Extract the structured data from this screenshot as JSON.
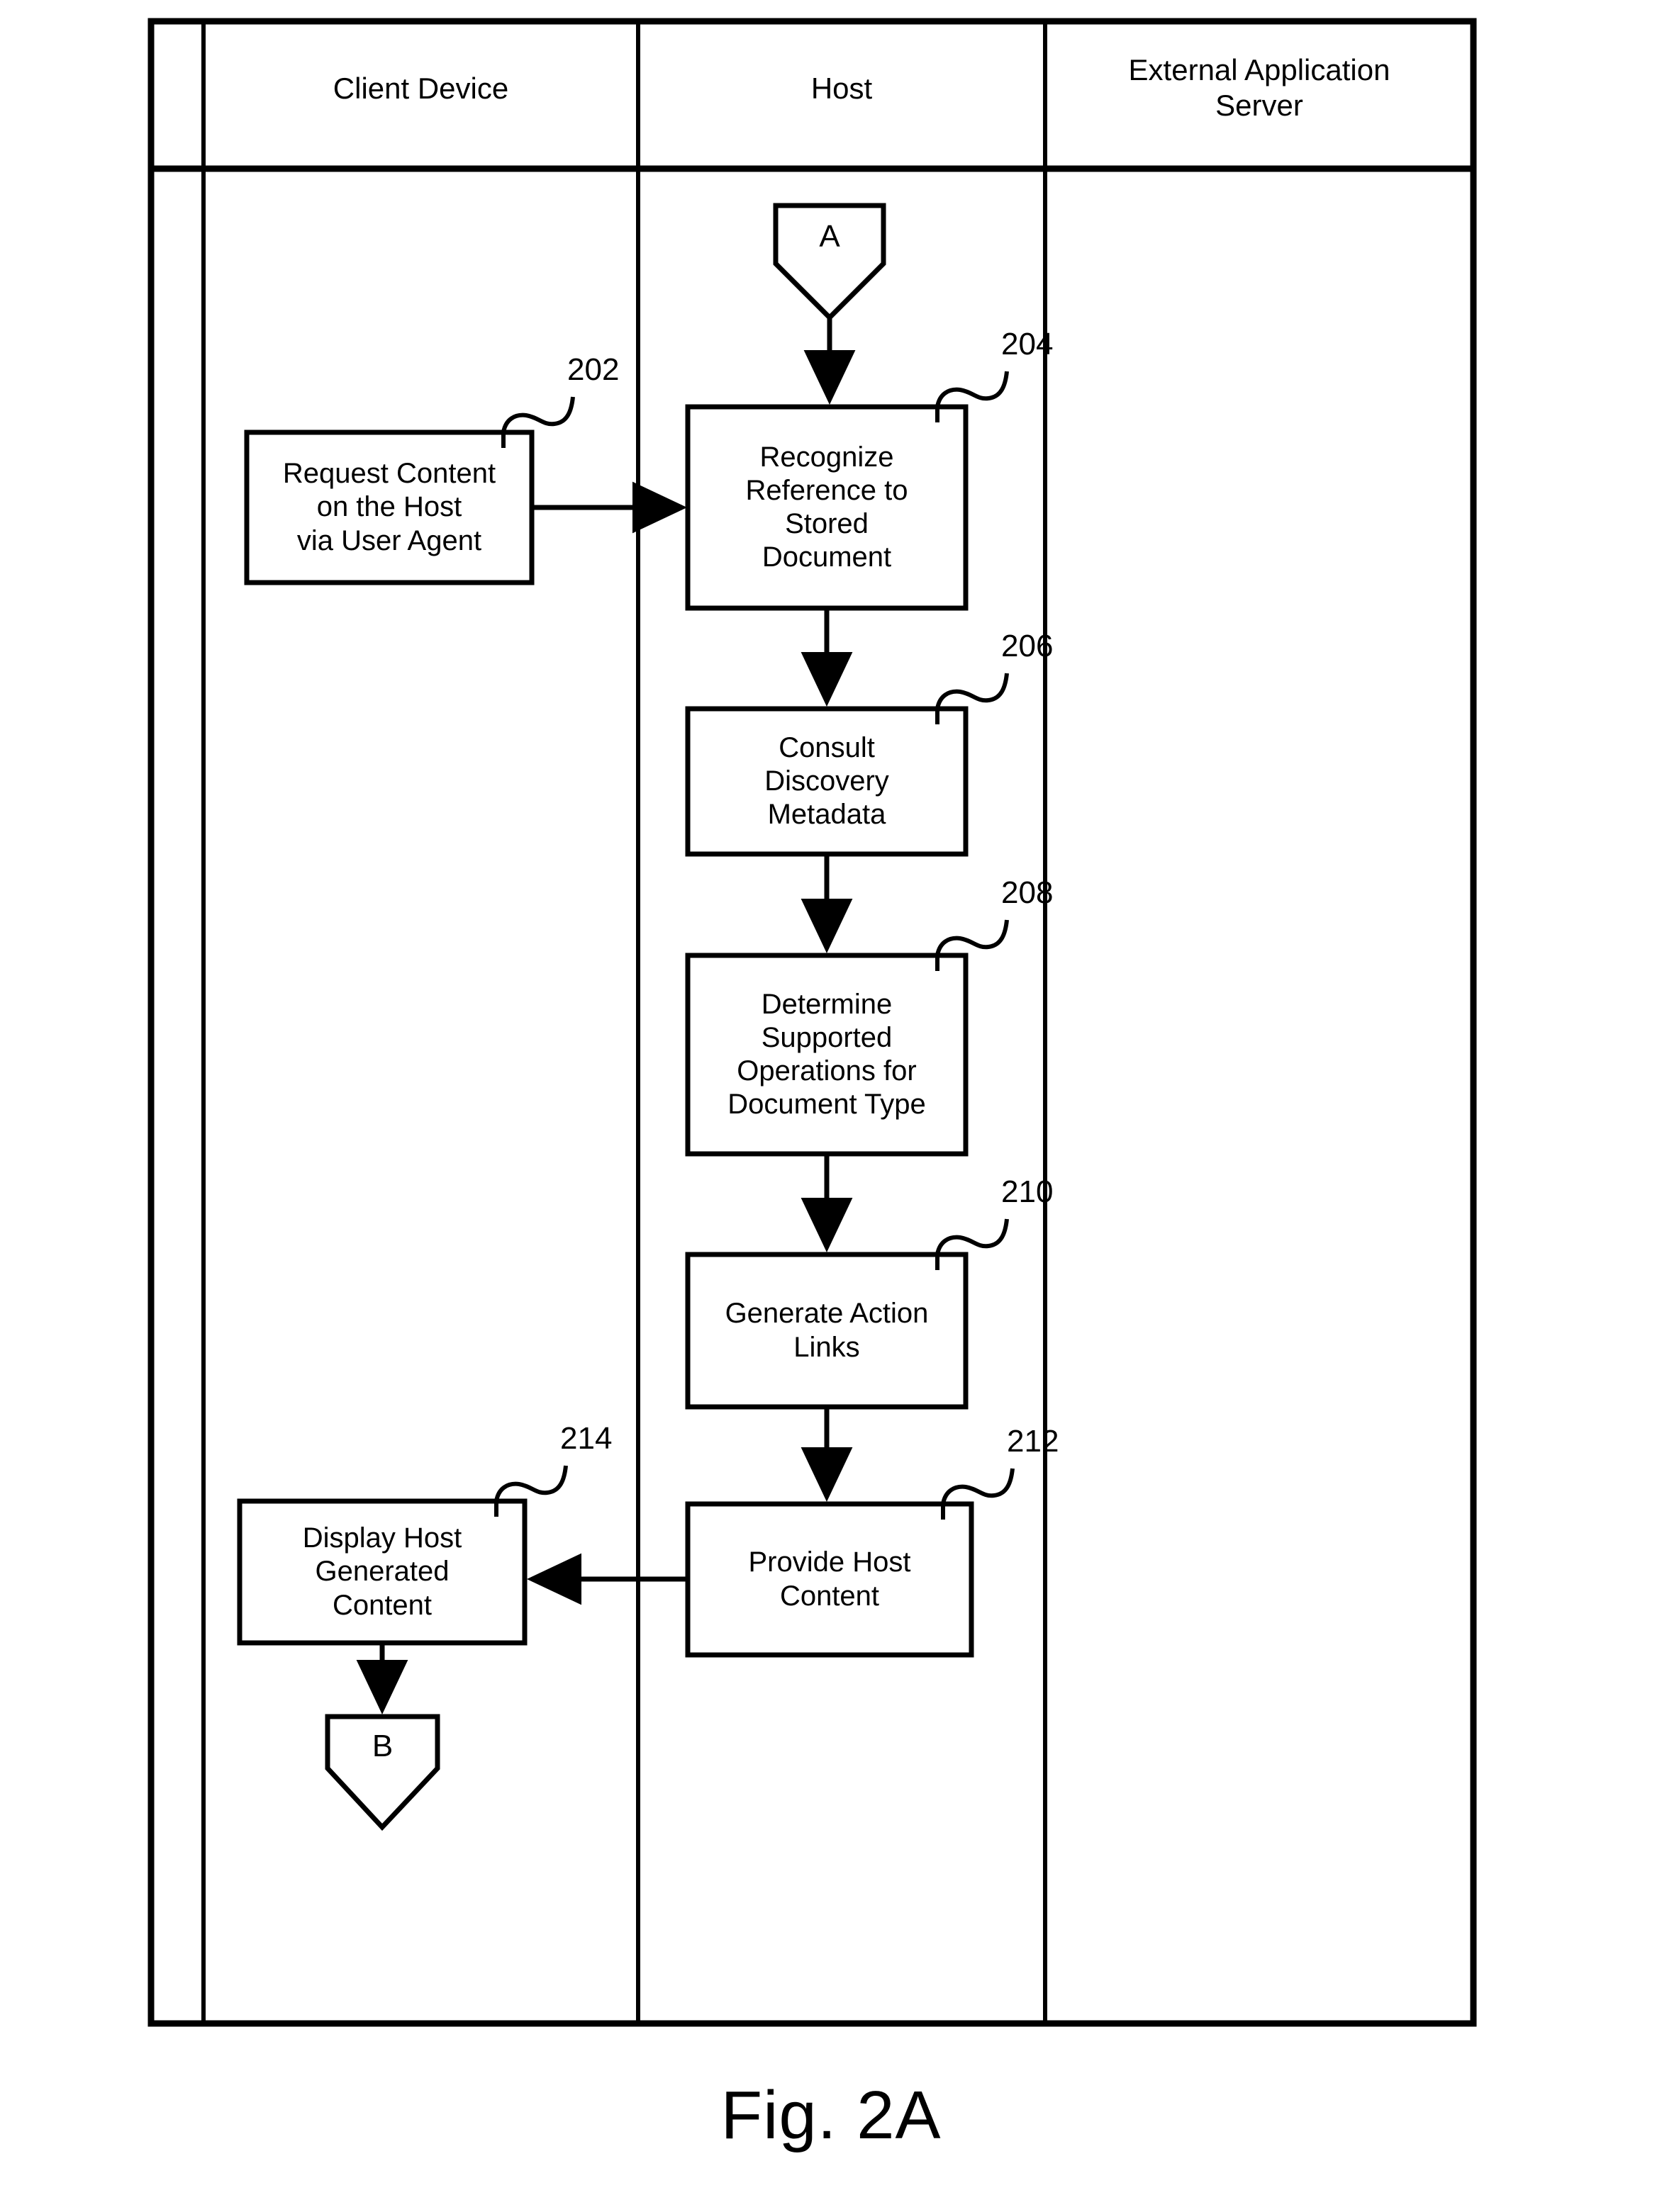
{
  "figure": {
    "caption": "Fig. 2A",
    "title_number": "2A"
  },
  "swimlanes": {
    "headers": [
      {
        "id": "client-device",
        "label": "Client Device"
      },
      {
        "id": "host",
        "label": "Host"
      },
      {
        "id": "external-application-server",
        "label": "External Application\nServer"
      }
    ]
  },
  "connectors": [
    {
      "id": "connector-a",
      "label": "A",
      "lane": "host"
    },
    {
      "id": "connector-b",
      "label": "B",
      "lane": "client-device"
    }
  ],
  "steps": [
    {
      "ref": "202",
      "lane": "client-device",
      "label": "Request Content\non the Host\nvia User Agent"
    },
    {
      "ref": "204",
      "lane": "host",
      "label": "Recognize\nReference to\nStored\nDocument"
    },
    {
      "ref": "206",
      "lane": "host",
      "label": "Consult\nDiscovery\nMetadata"
    },
    {
      "ref": "208",
      "lane": "host",
      "label": "Determine\nSupported\nOperations for\nDocument Type"
    },
    {
      "ref": "210",
      "lane": "host",
      "label": "Generate Action\nLinks"
    },
    {
      "ref": "212",
      "lane": "host",
      "label": "Provide Host\nContent"
    },
    {
      "ref": "214",
      "lane": "client-device",
      "label": "Display Host\nGenerated\nContent"
    }
  ],
  "flow_edges": [
    {
      "from": "connector-a",
      "to": "204",
      "direction": "down"
    },
    {
      "from": "202",
      "to": "204",
      "direction": "right"
    },
    {
      "from": "204",
      "to": "206",
      "direction": "down"
    },
    {
      "from": "206",
      "to": "208",
      "direction": "down"
    },
    {
      "from": "208",
      "to": "210",
      "direction": "down"
    },
    {
      "from": "210",
      "to": "212",
      "direction": "down"
    },
    {
      "from": "212",
      "to": "214",
      "direction": "left"
    },
    {
      "from": "214",
      "to": "connector-b",
      "direction": "down"
    }
  ],
  "style": {
    "line_color": "#000000",
    "background": "#ffffff"
  }
}
